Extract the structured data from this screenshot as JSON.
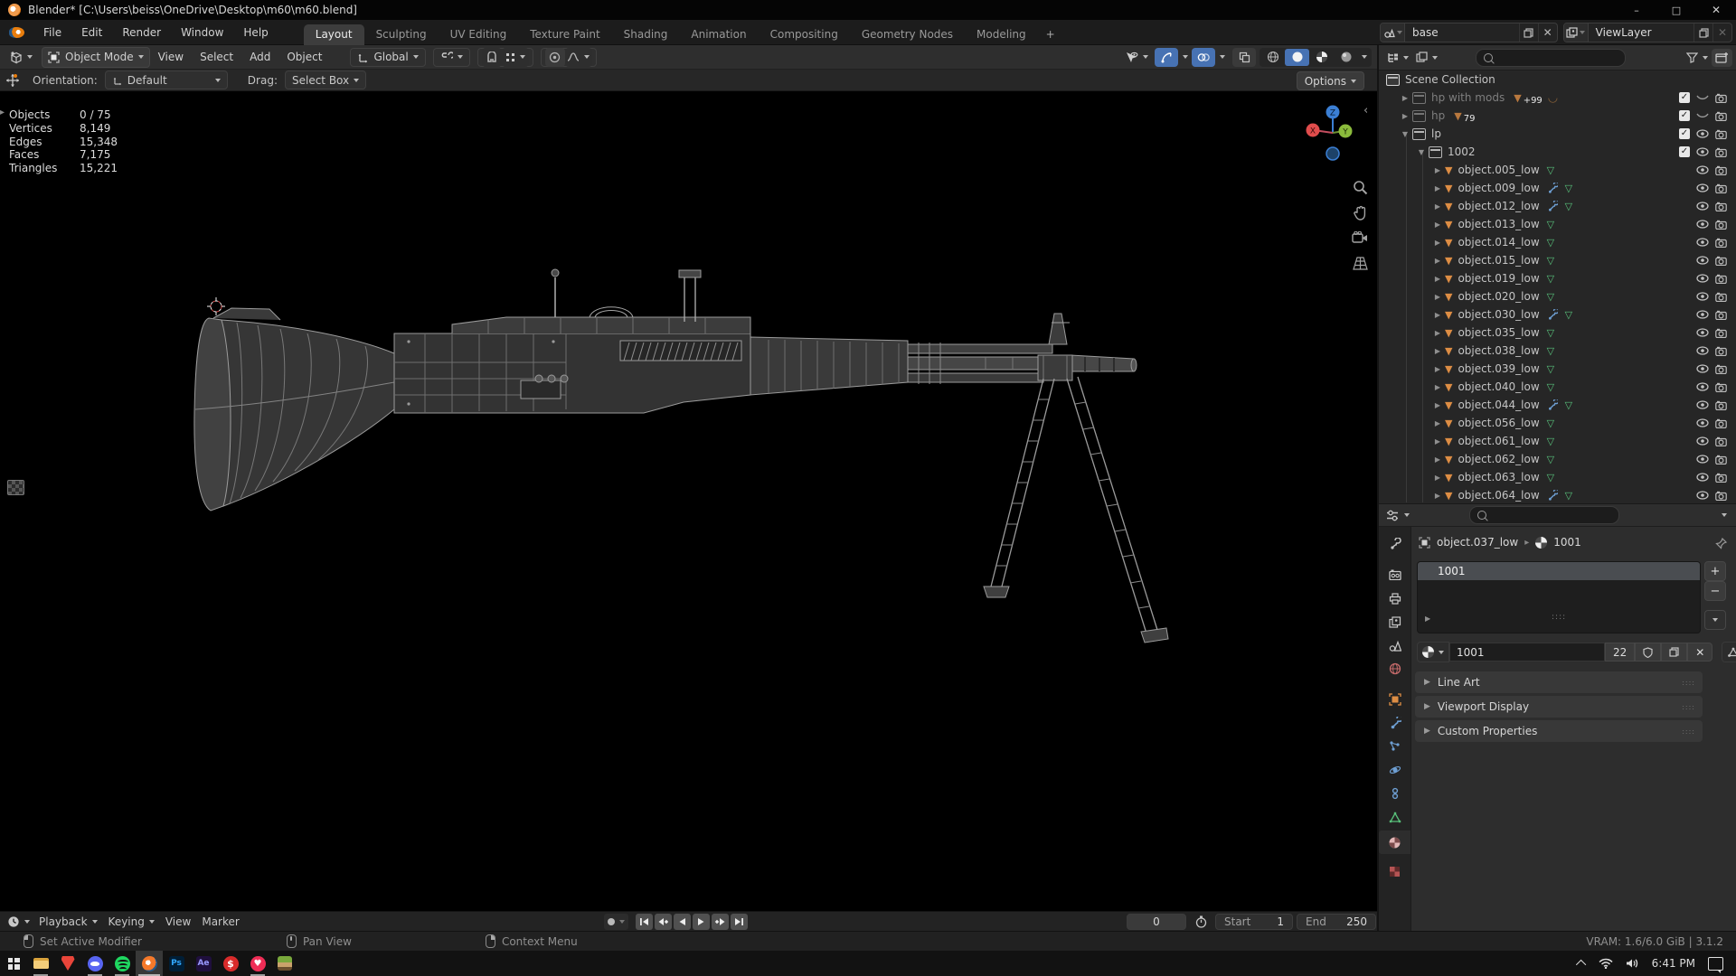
{
  "window": {
    "title": "Blender* [C:\\Users\\beiss\\OneDrive\\Desktop\\m60\\m60.blend]"
  },
  "menubar": {
    "menus": [
      "File",
      "Edit",
      "Render",
      "Window",
      "Help"
    ],
    "workspaces": [
      "Layout",
      "Sculpting",
      "UV Editing",
      "Texture Paint",
      "Shading",
      "Animation",
      "Compositing",
      "Geometry Nodes",
      "Modeling",
      "+"
    ],
    "active_workspace": "Layout"
  },
  "viewport_header": {
    "mode": "Object Mode",
    "menus": [
      "View",
      "Select",
      "Add",
      "Object"
    ],
    "orientation": "Global"
  },
  "tool_settings": {
    "orientation_label": "Orientation:",
    "orientation_value": "Default",
    "drag_label": "Drag:",
    "drag_value": "Select Box",
    "options": "Options"
  },
  "stats": {
    "rows": [
      {
        "label": "Objects",
        "value": "0 / 75"
      },
      {
        "label": "Vertices",
        "value": "8,149"
      },
      {
        "label": "Edges",
        "value": "15,348"
      },
      {
        "label": "Faces",
        "value": "7,175"
      },
      {
        "label": "Triangles",
        "value": "15,221"
      }
    ]
  },
  "gizmo": {
    "x": "X",
    "y": "Y",
    "z": "Z"
  },
  "outliner": {
    "scene": "base",
    "view_layer": "ViewLayer",
    "root": "Scene Collection",
    "collections": [
      {
        "name": "hp with mods",
        "badge": "+99",
        "dimmed": true,
        "eye": "closed"
      },
      {
        "name": "hp",
        "badge": "79",
        "dimmed": true,
        "eye": "closed"
      },
      {
        "name": "lp",
        "eye": "open",
        "expanded": true
      },
      {
        "name": "1002",
        "eye": "open",
        "expanded": true
      }
    ],
    "objects": [
      {
        "name": "object.005_low"
      },
      {
        "name": "object.009_low",
        "modifier": true
      },
      {
        "name": "object.012_low",
        "modifier": true
      },
      {
        "name": "object.013_low"
      },
      {
        "name": "object.014_low"
      },
      {
        "name": "object.015_low"
      },
      {
        "name": "object.019_low"
      },
      {
        "name": "object.020_low"
      },
      {
        "name": "object.030_low",
        "modifier": true
      },
      {
        "name": "object.035_low"
      },
      {
        "name": "object.038_low"
      },
      {
        "name": "object.039_low"
      },
      {
        "name": "object.040_low"
      },
      {
        "name": "object.044_low",
        "modifier": true
      },
      {
        "name": "object.056_low"
      },
      {
        "name": "object.061_low"
      },
      {
        "name": "object.062_low"
      },
      {
        "name": "object.063_low"
      },
      {
        "name": "object.064_low",
        "modifier": true
      }
    ]
  },
  "properties": {
    "breadcrumb": {
      "object": "object.037_low",
      "material": "1001"
    },
    "slot_name": "1001",
    "material": {
      "name": "1001",
      "users": "22"
    },
    "sections": [
      "Line Art",
      "Viewport Display",
      "Custom Properties"
    ]
  },
  "timeline": {
    "menus": [
      "Playback",
      "Keying",
      "View",
      "Marker"
    ],
    "current_frame": "0",
    "start_label": "Start",
    "start_value": "1",
    "end_label": "End",
    "end_value": "250"
  },
  "statusbar": {
    "hints": [
      {
        "label": "Set Active Modifier"
      },
      {
        "label": "Pan View"
      },
      {
        "label": "Context Menu"
      }
    ],
    "info": "VRAM: 1.6/6.0 GiB | 3.1.2"
  },
  "taskbar": {
    "time": "6:41 PM"
  },
  "colors": {
    "blender_orange": "#e87d0d",
    "accent_blue": "#4772b3",
    "axis_x": "#e04c4c",
    "axis_y": "#8bbb3c",
    "axis_z": "#3b7fd4",
    "mesh_orange": "#dd8d44",
    "mesh_data_green": "#58c07a",
    "modifier_blue": "#6e9fd3"
  }
}
